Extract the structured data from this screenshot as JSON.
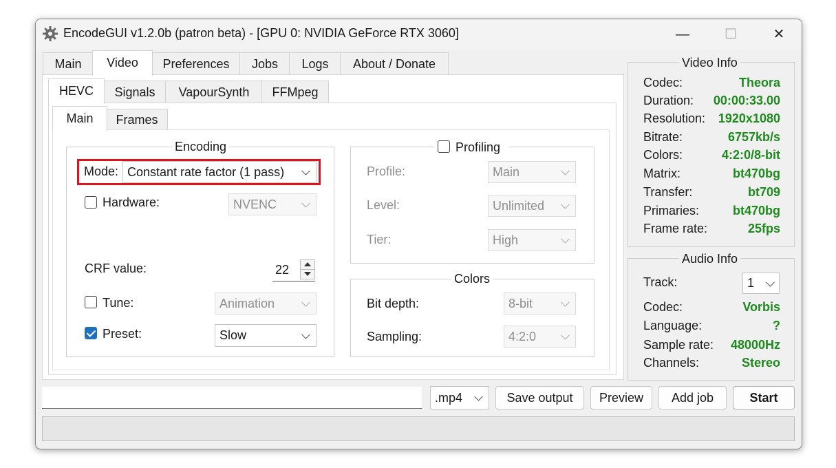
{
  "window": {
    "title": "EncodeGUI v1.2.0b (patron beta) - [GPU 0: NVIDIA GeForce RTX 3060]",
    "minimize": "—",
    "maximize": "☐",
    "close": "✕"
  },
  "main_tabs": [
    "Main",
    "Video",
    "Preferences",
    "Jobs",
    "Logs",
    "About / Donate"
  ],
  "active_main_tab": "Video",
  "codec_tabs": [
    "HEVC",
    "Signals",
    "VapourSynth",
    "FFMpeg"
  ],
  "active_codec_tab": "HEVC",
  "sub_tabs": [
    "Main",
    "Frames"
  ],
  "active_sub_tab": "Main",
  "encoding": {
    "legend": "Encoding",
    "mode_label": "Mode:",
    "mode_value": "Constant rate factor (1 pass)",
    "hardware_label": "Hardware:",
    "hardware_checked": false,
    "hardware_value": "NVENC",
    "crf_label": "CRF value:",
    "crf_value": "22",
    "tune_label": "Tune:",
    "tune_checked": false,
    "tune_value": "Animation",
    "preset_label": "Preset:",
    "preset_checked": true,
    "preset_value": "Slow"
  },
  "profiling": {
    "legend": "Profiling",
    "checked": false,
    "profile_label": "Profile:",
    "profile_value": "Main",
    "level_label": "Level:",
    "level_value": "Unlimited",
    "tier_label": "Tier:",
    "tier_value": "High"
  },
  "colors": {
    "legend": "Colors",
    "bit_depth_label": "Bit depth:",
    "bit_depth_value": "8-bit",
    "sampling_label": "Sampling:",
    "sampling_value": "4:2:0"
  },
  "video_info": {
    "title": "Video Info",
    "rows": [
      {
        "label": "Codec:",
        "value": "Theora"
      },
      {
        "label": "Duration:",
        "value": "00:00:33.00"
      },
      {
        "label": "Resolution:",
        "value": "1920x1080"
      },
      {
        "label": "Bitrate:",
        "value": "6757kb/s"
      },
      {
        "label": "Colors:",
        "value": "4:2:0/8-bit"
      },
      {
        "label": "Matrix:",
        "value": "bt470bg"
      },
      {
        "label": "Transfer:",
        "value": "bt709"
      },
      {
        "label": "Primaries:",
        "value": "bt470bg"
      },
      {
        "label": "Frame rate:",
        "value": "25fps"
      }
    ]
  },
  "audio_info": {
    "title": "Audio Info",
    "track_label": "Track:",
    "track_value": "1",
    "rows": [
      {
        "label": "Codec:",
        "value": "Vorbis"
      },
      {
        "label": "Language:",
        "value": "?"
      },
      {
        "label": "Sample rate:",
        "value": "48000Hz"
      },
      {
        "label": "Channels:",
        "value": "Stereo"
      }
    ]
  },
  "bottom": {
    "output_path": "",
    "container": ".mp4",
    "save_output": "Save output",
    "preview": "Preview",
    "add_job": "Add job",
    "start": "Start"
  },
  "colors_palette": {
    "highlight_box": "#e0121b",
    "info_value": "#1e8a1e",
    "check_on": "#1f6fbf"
  }
}
